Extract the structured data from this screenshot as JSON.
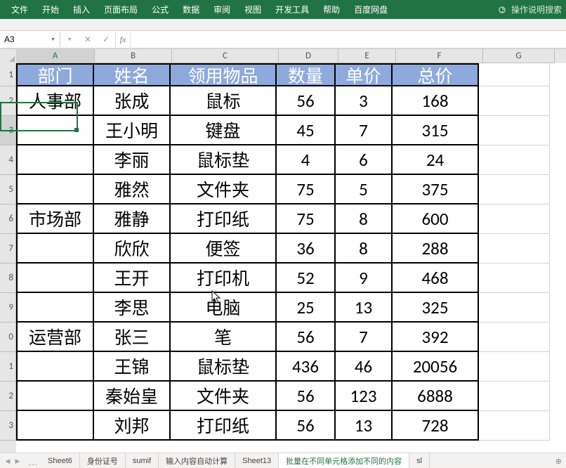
{
  "ribbon": {
    "tabs": [
      "文件",
      "开始",
      "插入",
      "页面布局",
      "公式",
      "数据",
      "审阅",
      "视图",
      "开发工具",
      "帮助",
      "百度网盘"
    ],
    "help": "操作说明搜索"
  },
  "namebox": {
    "ref": "A3"
  },
  "fxlabel": "fx",
  "cols": {
    "letters": [
      "A",
      "B",
      "C",
      "D",
      "E",
      "F",
      "G"
    ],
    "widths": [
      111,
      109,
      151,
      84,
      81,
      123,
      101
    ],
    "selIdx": 0
  },
  "rowLabels": [
    "1",
    "2",
    "3",
    "4",
    "5",
    "6",
    "7",
    "8",
    "9",
    "0",
    "1",
    "2",
    "3"
  ],
  "rowSelIdx": 2,
  "headers": [
    "部门",
    "姓名",
    "领用物品",
    "数量",
    "单价",
    "总价"
  ],
  "rows": [
    {
      "dept": "人事部",
      "name": "张成",
      "item": "鼠标",
      "qty": "56",
      "price": "3",
      "total": "168"
    },
    {
      "dept": "",
      "name": "王小明",
      "item": "键盘",
      "qty": "45",
      "price": "7",
      "total": "315"
    },
    {
      "dept": "",
      "name": "李丽",
      "item": "鼠标垫",
      "qty": "4",
      "price": "6",
      "total": "24"
    },
    {
      "dept": "",
      "name": "雅然",
      "item": "文件夹",
      "qty": "75",
      "price": "5",
      "total": "375"
    },
    {
      "dept": "市场部",
      "name": "雅静",
      "item": "打印纸",
      "qty": "75",
      "price": "8",
      "total": "600"
    },
    {
      "dept": "",
      "name": "欣欣",
      "item": "便签",
      "qty": "36",
      "price": "8",
      "total": "288"
    },
    {
      "dept": "",
      "name": "王开",
      "item": "打印机",
      "qty": "52",
      "price": "9",
      "total": "468"
    },
    {
      "dept": "",
      "name": "李思",
      "item": "电脑",
      "qty": "25",
      "price": "13",
      "total": "325"
    },
    {
      "dept": "运营部",
      "name": "张三",
      "item": "笔",
      "qty": "56",
      "price": "7",
      "total": "392"
    },
    {
      "dept": "",
      "name": "王锦",
      "item": "鼠标垫",
      "qty": "436",
      "price": "46",
      "total": "20056"
    },
    {
      "dept": "",
      "name": "秦始皇",
      "item": "文件夹",
      "qty": "56",
      "price": "123",
      "total": "6888"
    },
    {
      "dept": "",
      "name": "刘邦",
      "item": "打印纸",
      "qty": "56",
      "price": "13",
      "total": "728"
    }
  ],
  "sheetTabs": [
    {
      "label": "Sheet6",
      "active": false
    },
    {
      "label": "身份证号",
      "active": false
    },
    {
      "label": "sumif",
      "active": false
    },
    {
      "label": "输入内容自动计算",
      "active": false
    },
    {
      "label": "Sheet13",
      "active": false
    },
    {
      "label": "批量在不同单元格添加不同的内容",
      "active": true
    },
    {
      "label": "sl",
      "active": false
    }
  ],
  "chart_data": {
    "type": "table",
    "title": "",
    "columns": [
      "部门",
      "姓名",
      "领用物品",
      "数量",
      "单价",
      "总价"
    ],
    "rows": [
      [
        "人事部",
        "张成",
        "鼠标",
        56,
        3,
        168
      ],
      [
        "",
        "王小明",
        "键盘",
        45,
        7,
        315
      ],
      [
        "",
        "李丽",
        "鼠标垫",
        4,
        6,
        24
      ],
      [
        "",
        "雅然",
        "文件夹",
        75,
        5,
        375
      ],
      [
        "市场部",
        "雅静",
        "打印纸",
        75,
        8,
        600
      ],
      [
        "",
        "欣欣",
        "便签",
        36,
        8,
        288
      ],
      [
        "",
        "王开",
        "打印机",
        52,
        9,
        468
      ],
      [
        "",
        "李思",
        "电脑",
        25,
        13,
        325
      ],
      [
        "运营部",
        "张三",
        "笔",
        56,
        7,
        392
      ],
      [
        "",
        "王锦",
        "鼠标垫",
        436,
        46,
        20056
      ],
      [
        "",
        "秦始皇",
        "文件夹",
        56,
        123,
        6888
      ],
      [
        "",
        "刘邦",
        "打印纸",
        56,
        13,
        728
      ]
    ]
  }
}
